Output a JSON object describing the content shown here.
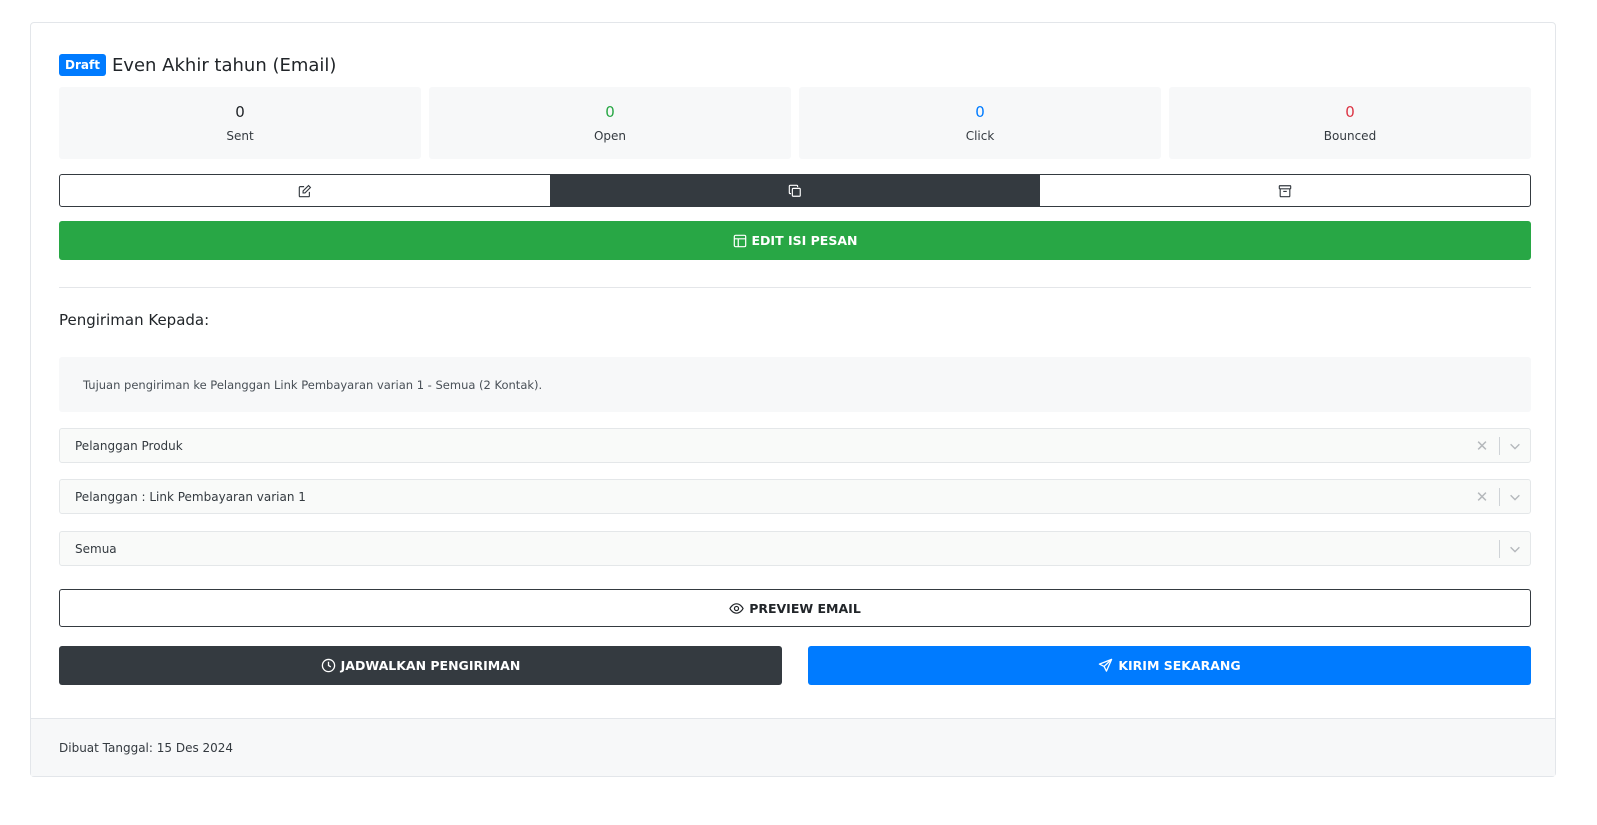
{
  "header": {
    "status_badge": "Draft",
    "title": "Even Akhir tahun (Email)"
  },
  "stats": [
    {
      "value": "0",
      "label": "Sent",
      "color": "#212529"
    },
    {
      "value": "0",
      "label": "Open",
      "color": "#28a745"
    },
    {
      "value": "0",
      "label": "Click",
      "color": "#007bff"
    },
    {
      "value": "0",
      "label": "Bounced",
      "color": "#dc3545"
    }
  ],
  "actions": {
    "edit_icon": "edit-icon",
    "duplicate_icon": "copy-icon",
    "archive_icon": "archive-icon",
    "edit_content_label": "EDIT ISI PESAN"
  },
  "recipients": {
    "section_title": "Pengiriman Kepada:",
    "info_text": "Tujuan pengiriman ke Pelanggan Link Pembayaran varian 1 - Semua (2 Kontak).",
    "selects": [
      {
        "value": "Pelanggan Produk",
        "clearable": true
      },
      {
        "value": "Pelanggan : Link Pembayaran varian 1",
        "clearable": true
      },
      {
        "value": "Semua",
        "clearable": false
      }
    ]
  },
  "buttons": {
    "preview_label": "PREVIEW EMAIL",
    "schedule_label": "JADWALKAN PENGIRIMAN",
    "send_label": "KIRIM SEKARANG"
  },
  "footer": {
    "created_text": "Dibuat Tanggal: 15 Des 2024"
  },
  "colors": {
    "primary": "#007bff",
    "success": "#28a745",
    "dark": "#343a40",
    "danger": "#dc3545"
  }
}
